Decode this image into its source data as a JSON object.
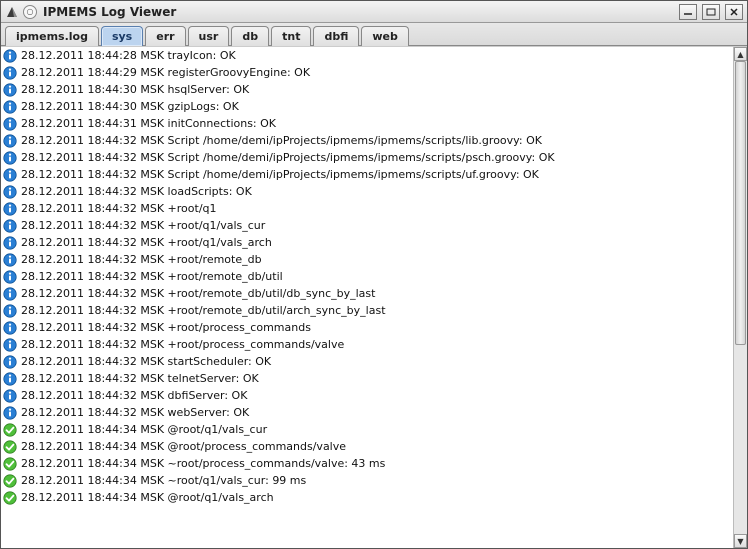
{
  "window": {
    "title": "IPMEMS Log Viewer"
  },
  "tabs": [
    {
      "label": "ipmems.log",
      "active": false
    },
    {
      "label": "sys",
      "active": true
    },
    {
      "label": "err",
      "active": false
    },
    {
      "label": "usr",
      "active": false
    },
    {
      "label": "db",
      "active": false
    },
    {
      "label": "tnt",
      "active": false
    },
    {
      "label": "dbfi",
      "active": false
    },
    {
      "label": "web",
      "active": false
    }
  ],
  "log": {
    "entries": [
      {
        "icon": "info",
        "text": "28.12.2011 18:44:28 MSK trayIcon: OK"
      },
      {
        "icon": "info",
        "text": "28.12.2011 18:44:29 MSK registerGroovyEngine: OK"
      },
      {
        "icon": "info",
        "text": "28.12.2011 18:44:30 MSK hsqlServer: OK"
      },
      {
        "icon": "info",
        "text": "28.12.2011 18:44:30 MSK gzipLogs: OK"
      },
      {
        "icon": "info",
        "text": "28.12.2011 18:44:31 MSK initConnections: OK"
      },
      {
        "icon": "info",
        "text": "28.12.2011 18:44:32 MSK Script /home/demi/ipProjects/ipmems/ipmems/scripts/lib.groovy: OK"
      },
      {
        "icon": "info",
        "text": "28.12.2011 18:44:32 MSK Script /home/demi/ipProjects/ipmems/ipmems/scripts/psch.groovy: OK"
      },
      {
        "icon": "info",
        "text": "28.12.2011 18:44:32 MSK Script /home/demi/ipProjects/ipmems/ipmems/scripts/uf.groovy: OK"
      },
      {
        "icon": "info",
        "text": "28.12.2011 18:44:32 MSK loadScripts: OK"
      },
      {
        "icon": "info",
        "text": "28.12.2011 18:44:32 MSK +root/q1"
      },
      {
        "icon": "info",
        "text": "28.12.2011 18:44:32 MSK +root/q1/vals_cur"
      },
      {
        "icon": "info",
        "text": "28.12.2011 18:44:32 MSK +root/q1/vals_arch"
      },
      {
        "icon": "info",
        "text": "28.12.2011 18:44:32 MSK +root/remote_db"
      },
      {
        "icon": "info",
        "text": "28.12.2011 18:44:32 MSK +root/remote_db/util"
      },
      {
        "icon": "info",
        "text": "28.12.2011 18:44:32 MSK +root/remote_db/util/db_sync_by_last"
      },
      {
        "icon": "info",
        "text": "28.12.2011 18:44:32 MSK +root/remote_db/util/arch_sync_by_last"
      },
      {
        "icon": "info",
        "text": "28.12.2011 18:44:32 MSK +root/process_commands"
      },
      {
        "icon": "info",
        "text": "28.12.2011 18:44:32 MSK +root/process_commands/valve"
      },
      {
        "icon": "info",
        "text": "28.12.2011 18:44:32 MSK startScheduler: OK"
      },
      {
        "icon": "info",
        "text": "28.12.2011 18:44:32 MSK telnetServer: OK"
      },
      {
        "icon": "info",
        "text": "28.12.2011 18:44:32 MSK dbfiServer: OK"
      },
      {
        "icon": "info",
        "text": "28.12.2011 18:44:32 MSK webServer: OK"
      },
      {
        "icon": "ok",
        "text": "28.12.2011 18:44:34 MSK @root/q1/vals_cur"
      },
      {
        "icon": "ok",
        "text": "28.12.2011 18:44:34 MSK @root/process_commands/valve"
      },
      {
        "icon": "ok",
        "text": "28.12.2011 18:44:34 MSK ~root/process_commands/valve: 43 ms"
      },
      {
        "icon": "ok",
        "text": "28.12.2011 18:44:34 MSK ~root/q1/vals_cur: 99 ms"
      },
      {
        "icon": "ok",
        "text": "28.12.2011 18:44:34 MSK @root/q1/vals_arch"
      }
    ]
  },
  "icons": {
    "info_color": "#2a7fd4",
    "ok_color": "#4fbf3a"
  }
}
